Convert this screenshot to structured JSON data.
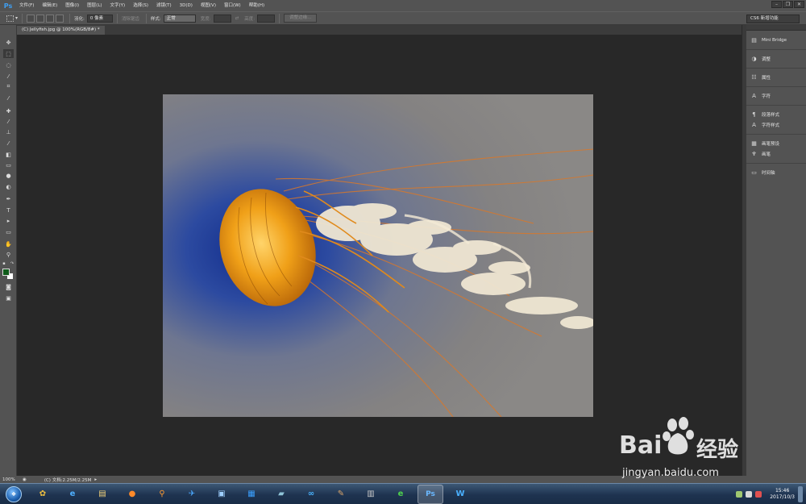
{
  "app": {
    "logo": "Ps"
  },
  "menu": [
    "文件(F)",
    "编辑(E)",
    "图像(I)",
    "图层(L)",
    "文字(Y)",
    "选择(S)",
    "滤镜(T)",
    "3D(D)",
    "视图(V)",
    "窗口(W)",
    "帮助(H)"
  ],
  "options": {
    "feather_label": "羽化:",
    "feather_value": "0 像素",
    "antialias_label": "消除锯齿",
    "style_label": "样式:",
    "style_value": "正常",
    "width_label": "宽度:",
    "height_label": "高度:",
    "refine_button": "调整边缘...",
    "workspace": "CS6 新增功能"
  },
  "document": {
    "tab_title": "(C) Jellyfish.jpg @ 100%(RGB/8#) *"
  },
  "panels": [
    "Mini Bridge",
    "调整",
    "属性",
    "字符",
    "段落样式",
    "字符样式",
    "画笔预设",
    "画笔",
    "时间轴"
  ],
  "status": {
    "zoom": "100%",
    "doc_info": "(C) 文档:2.25M/2.25M"
  },
  "clock": {
    "time": "15:46",
    "date": "2017/10/3"
  },
  "watermark": {
    "brand": "Bai",
    "brand2": "经验",
    "sub": "jingyan.baidu.com"
  },
  "colors": {
    "foreground": "#0f5b1a",
    "background": "#ffffff",
    "ps_blue": "#3f9ef0"
  },
  "taskbar": {
    "apps": [
      "start",
      "photos-app",
      "ie-browser",
      "file-explorer",
      "firefox",
      "search-tool",
      "feishu-app",
      "remote-desktop",
      "grid-app",
      "notes-app",
      "baidu-netdisk",
      "paint-app",
      "calculator",
      "ie-green",
      "photoshop",
      "wps"
    ]
  }
}
